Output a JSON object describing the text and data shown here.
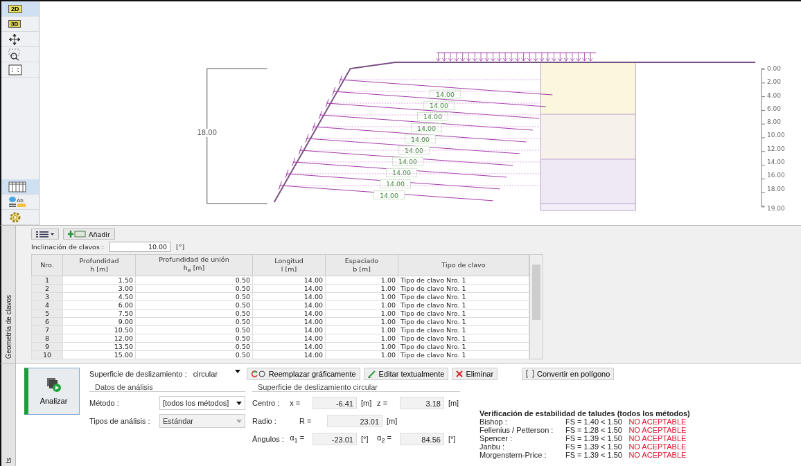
{
  "toolbar": {
    "top_items": [
      {
        "kind": "plan",
        "label": "2D",
        "selected": true
      },
      {
        "kind": "solid",
        "label": "3D",
        "selected": false
      },
      {
        "kind": "move",
        "selected": false
      },
      {
        "kind": "zoom",
        "selected": false
      },
      {
        "kind": "fit",
        "selected": false
      }
    ],
    "bottom_items": [
      {
        "kind": "table",
        "selected": true
      },
      {
        "kind": "labels",
        "label": "Ab",
        "selected": false
      },
      {
        "kind": "settings",
        "selected": false
      }
    ]
  },
  "drawing": {
    "height_dimension": "18.00",
    "nail_lengths": [
      "14.00",
      "14.00",
      "14.00",
      "14.00",
      "14.00",
      "14.00",
      "14.00",
      "14.00",
      "14.00",
      "14.00"
    ],
    "depth_scale": [
      "0.00",
      "2.00",
      "4.00",
      "6.00",
      "8.00",
      "10.00",
      "12.00",
      "14.00",
      "16.00",
      "18.00",
      "19.00"
    ]
  },
  "nails_panel": {
    "side_tab": "Geometría de clavos",
    "add_button": "Añadir",
    "inclination": {
      "label": "Inclinación de clavos :",
      "value": "10.00",
      "unit": "[°]"
    },
    "table": {
      "columns": [
        {
          "label": "Nro."
        },
        {
          "label": "Profundidad",
          "unit": "h  [m]"
        },
        {
          "label": "Profundidad de unión",
          "unit": "h$_{e}$  [m]"
        },
        {
          "label": "Longitud",
          "unit": "l  [m]"
        },
        {
          "label": "Espaciado",
          "unit": "b  [m]"
        },
        {
          "label": "Tipo de clavo"
        }
      ],
      "rows": [
        [
          "1",
          "1.50",
          "0.50",
          "14.00",
          "1.00",
          "Tipo de clavo Nro. 1"
        ],
        [
          "2",
          "3.00",
          "0.50",
          "14.00",
          "1.00",
          "Tipo de clavo Nro. 1"
        ],
        [
          "3",
          "4.50",
          "0.50",
          "14.00",
          "1.00",
          "Tipo de clavo Nro. 1"
        ],
        [
          "4",
          "6.00",
          "0.50",
          "14.00",
          "1.00",
          "Tipo de clavo Nro. 1"
        ],
        [
          "5",
          "7.50",
          "0.50",
          "14.00",
          "1.00",
          "Tipo de clavo Nro. 1"
        ],
        [
          "6",
          "9.00",
          "0.50",
          "14.00",
          "1.00",
          "Tipo de clavo Nro. 1"
        ],
        [
          "7",
          "10.50",
          "0.50",
          "14.00",
          "1.00",
          "Tipo de clavo Nro. 1"
        ],
        [
          "8",
          "12.00",
          "0.50",
          "14.00",
          "1.00",
          "Tipo de clavo Nro. 1"
        ],
        [
          "9",
          "13.50",
          "0.50",
          "14.00",
          "1.00",
          "Tipo de clavo Nro. 1"
        ],
        [
          "10",
          "15.00",
          "0.50",
          "14.00",
          "1.00",
          "Tipo de clavo Nro. 1"
        ]
      ]
    }
  },
  "analysis": {
    "side_tab": "ts",
    "run_button": "Analizar",
    "slip_surface": {
      "label": "Superficie de deslizamiento :",
      "value": "circular"
    },
    "actions": [
      {
        "kind": "replace",
        "label": "Reemplazar gráficamente"
      },
      {
        "kind": "edit",
        "label": "Editar textualmente"
      },
      {
        "kind": "delete",
        "label": "Eliminar"
      },
      {
        "kind": "polygon",
        "label": "Convertir en polígono"
      }
    ],
    "analysis_data": {
      "title": "Datos de análisis",
      "fields": [
        {
          "label": "Método :",
          "value": "[todos los métodos]",
          "disabled": false
        },
        {
          "label": "Tipos de análisis :",
          "value": "Estándar",
          "disabled": true
        }
      ]
    },
    "circle": {
      "title": "Superficie de deslizamiento circular",
      "rows": [
        {
          "label": "Centro :",
          "fields": [
            {
              "symbol": "x =",
              "value": "-6.41",
              "unit": "[m]"
            },
            {
              "symbol": "z =",
              "value": "3.18",
              "unit": "[m]"
            }
          ]
        },
        {
          "label": "Radio :",
          "fields": [
            {
              "symbol": "R =",
              "value": "23.01",
              "unit": "[m]"
            }
          ]
        },
        {
          "label": "Ángulos :",
          "fields": [
            {
              "symbol": "α$_{1}$ =",
              "value": "-23.01",
              "unit": "[°]"
            },
            {
              "symbol": "α$_{2}$ =",
              "value": "84.56",
              "unit": "[°]"
            }
          ]
        }
      ]
    },
    "results": {
      "title": "Verificación de estabilidad de taludes (todos los métodos)",
      "rows": [
        {
          "method": "Bishop :",
          "value": "FS = 1.40 < 1.50",
          "verdict": "NO ACEPTABLE"
        },
        {
          "method": "Fellenius / Petterson :",
          "value": "FS = 1.28 < 1.50",
          "verdict": "NO ACEPTABLE"
        },
        {
          "method": "Spencer :",
          "value": "FS = 1.39 < 1.50",
          "verdict": "NO ACEPTABLE"
        },
        {
          "method": "Janbu :",
          "value": "FS = 1.39 < 1.50",
          "verdict": "NO ACEPTABLE"
        },
        {
          "method": "Morgenstern-Price :",
          "value": "FS = 1.39 < 1.50",
          "verdict": "NO ACEPTABLE"
        }
      ]
    }
  }
}
